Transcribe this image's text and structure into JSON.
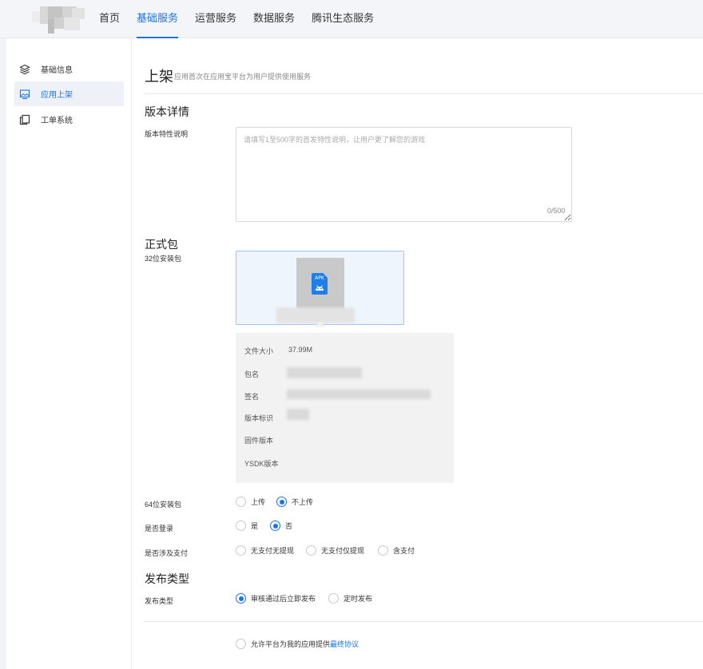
{
  "nav": {
    "items": [
      {
        "label": "首页",
        "active": false
      },
      {
        "label": "基础服务",
        "active": true
      },
      {
        "label": "运营服务",
        "active": false
      },
      {
        "label": "数据服务",
        "active": false
      },
      {
        "label": "腾讯生态服务",
        "active": false
      }
    ]
  },
  "sidebar": {
    "items": [
      {
        "label": "基础信息",
        "icon": "layers-icon",
        "active": false
      },
      {
        "label": "应用上架",
        "icon": "picture-icon",
        "active": true
      },
      {
        "label": "工单系统",
        "icon": "copy-icon",
        "active": false
      }
    ]
  },
  "page": {
    "title": "上架",
    "subtitle": "应用首次在应用宝平台为用户提供使用服务"
  },
  "version_section": {
    "title": "版本详情",
    "feature_label": "版本特性说明",
    "feature_placeholder": "请填写1至500字的首发特性说明，让用户更了解您的游戏",
    "feature_value": "",
    "counter": "0/500"
  },
  "package_section": {
    "title": "正式包",
    "pkg32_label": "32位安装包",
    "apk_badge": "APK",
    "info": [
      {
        "label": "文件大小",
        "value": "37.99M"
      },
      {
        "label": "包名",
        "value": ""
      },
      {
        "label": "签名",
        "value": ""
      },
      {
        "label": "版本标识",
        "value": ""
      },
      {
        "label": "固件版本",
        "value": ""
      },
      {
        "label": "YSDK版本",
        "value": ""
      }
    ],
    "pkg64": {
      "label": "64位安装包",
      "options": [
        {
          "label": "上传",
          "checked": false
        },
        {
          "label": "不上传",
          "checked": true
        }
      ]
    },
    "login": {
      "label": "是否登录",
      "options": [
        {
          "label": "是",
          "checked": false
        },
        {
          "label": "否",
          "checked": true
        }
      ]
    },
    "payment": {
      "label": "是否涉及支付",
      "options": [
        {
          "label": "无支付无提现",
          "checked": false
        },
        {
          "label": "无支付仅提现",
          "checked": false
        },
        {
          "label": "含支付",
          "checked": false
        }
      ]
    }
  },
  "publish_section": {
    "title": "发布类型",
    "label": "发布类型",
    "options": [
      {
        "label": "审核通过后立即发布",
        "checked": true
      },
      {
        "label": "定时发布",
        "checked": false
      }
    ]
  },
  "agreement": {
    "prefix": "允许平台为我的应用提供",
    "link": "最终协议",
    "checked": false
  },
  "colors": {
    "accent": "#1a73e8",
    "upload_bg": "#eef5fd",
    "panel_bg": "#f2f2f2"
  }
}
